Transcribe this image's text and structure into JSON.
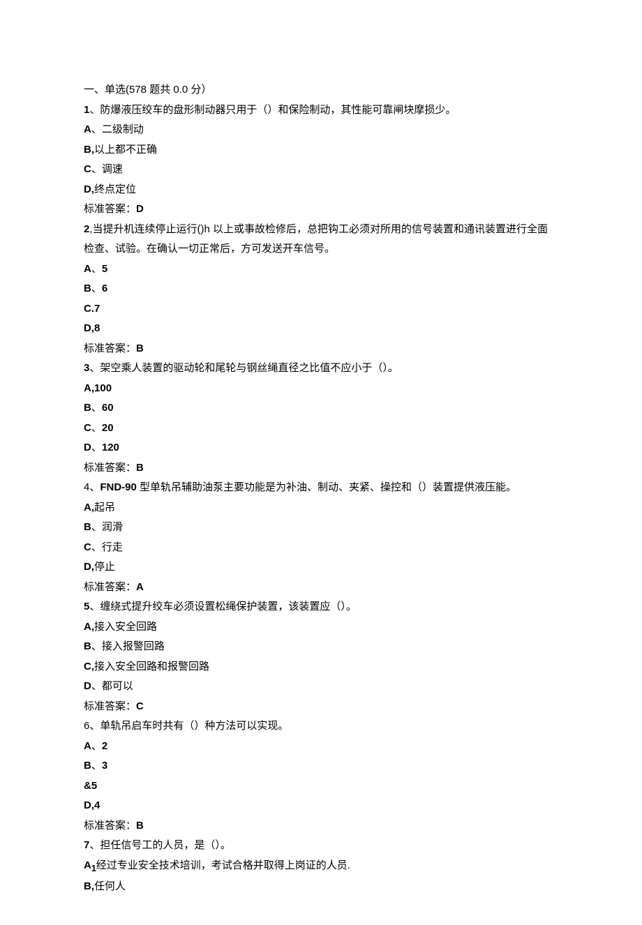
{
  "header": "一、单选(578 题共 0.0 分）",
  "questions": [
    {
      "num": "1",
      "text": "、防爆液压绞车的盘形制动器只用于（）和保险制动，其性能可靠闸块摩损少。",
      "options": [
        {
          "label": "A",
          "sep": "、",
          "text": "二级制动"
        },
        {
          "label": "B",
          "sep": ",",
          "text": "以上都不正确"
        },
        {
          "label": "C",
          "sep": "、",
          "text": "调速"
        },
        {
          "label": "D",
          "sep": ",",
          "text": "终点定位"
        }
      ],
      "answer_label": "标准答案：",
      "answer": "D"
    },
    {
      "num": "2",
      "text": ",当提升机连续停止运行()h 以上或事故检修后，总把钩工必须对所用的信号装置和通讯装置进行全面检查、试验。在确认一切正常后，方可发送开车信号。",
      "options": [
        {
          "label": "A",
          "sep": "、",
          "text": "5"
        },
        {
          "label": "B",
          "sep": "、",
          "text": "6"
        },
        {
          "label": "C",
          "sep": ".",
          "text": "7"
        },
        {
          "label": "D",
          "sep": ",",
          "text": "8"
        }
      ],
      "answer_label": "标准答案：",
      "answer": "B"
    },
    {
      "num": "3",
      "text": "、架空乘人装置的驱动轮和尾轮与钢丝绳直径之比值不应小于（）。",
      "options": [
        {
          "label": "A",
          "sep": ",",
          "text": "100"
        },
        {
          "label": "B",
          "sep": "、",
          "text": "60"
        },
        {
          "label": "C",
          "sep": "、",
          "text": "20"
        },
        {
          "label": "D",
          "sep": "、",
          "text": "120"
        }
      ],
      "answer_label": "标准答案：",
      "answer": "B"
    },
    {
      "num": "4",
      "text_prefix": "、",
      "text_bold": "FND-90",
      "text_suffix": " 型单轨吊辅助油泵主要功能是为补油、制动、夹紧、操控和（）装置提供液压能。",
      "options": [
        {
          "label": "A",
          "sep": ",",
          "text": "起吊"
        },
        {
          "label": "B",
          "sep": "、",
          "text": "润滑"
        },
        {
          "label": "C",
          "sep": "、",
          "text": "行走"
        },
        {
          "label": "D",
          "sep": ",",
          "text": "停止"
        }
      ],
      "answer_label": "标准答案：",
      "answer": "A"
    },
    {
      "num": "5",
      "text": "、缠绕式提升绞车必须设置松绳保护装置，该装置应（）。",
      "options": [
        {
          "label": "A",
          "sep": ",",
          "text": "接入安全回路"
        },
        {
          "label": "B",
          "sep": "、",
          "text": "接入报警回路"
        },
        {
          "label": "C",
          "sep": ",",
          "text": "接入安全回路和报警回路"
        },
        {
          "label": "D",
          "sep": "、",
          "text": "都可以"
        }
      ],
      "answer_label": "标准答案：",
      "answer": "C"
    },
    {
      "num": "6",
      "text": "、单轨吊启车时共有（）种方法可以实现。",
      "options": [
        {
          "label": "A",
          "sep": "、",
          "text": "2"
        },
        {
          "label": "B",
          "sep": "、",
          "text": "3"
        },
        {
          "label": "&",
          "sep": "",
          "text": "5"
        },
        {
          "label": "D",
          "sep": ",",
          "text": "4"
        }
      ],
      "answer_label": "标准答案：",
      "answer": "B"
    },
    {
      "num": "7",
      "text": "、担任信号工的人员，是（）。",
      "options": [
        {
          "label": "A",
          "sub": "1",
          "sep": "",
          "text": "经过专业安全技术培训，考试合格并取得上岗证的人员."
        },
        {
          "label": "B",
          "sep": ",",
          "text": "任何人"
        }
      ],
      "answer_label": "",
      "answer": ""
    }
  ]
}
